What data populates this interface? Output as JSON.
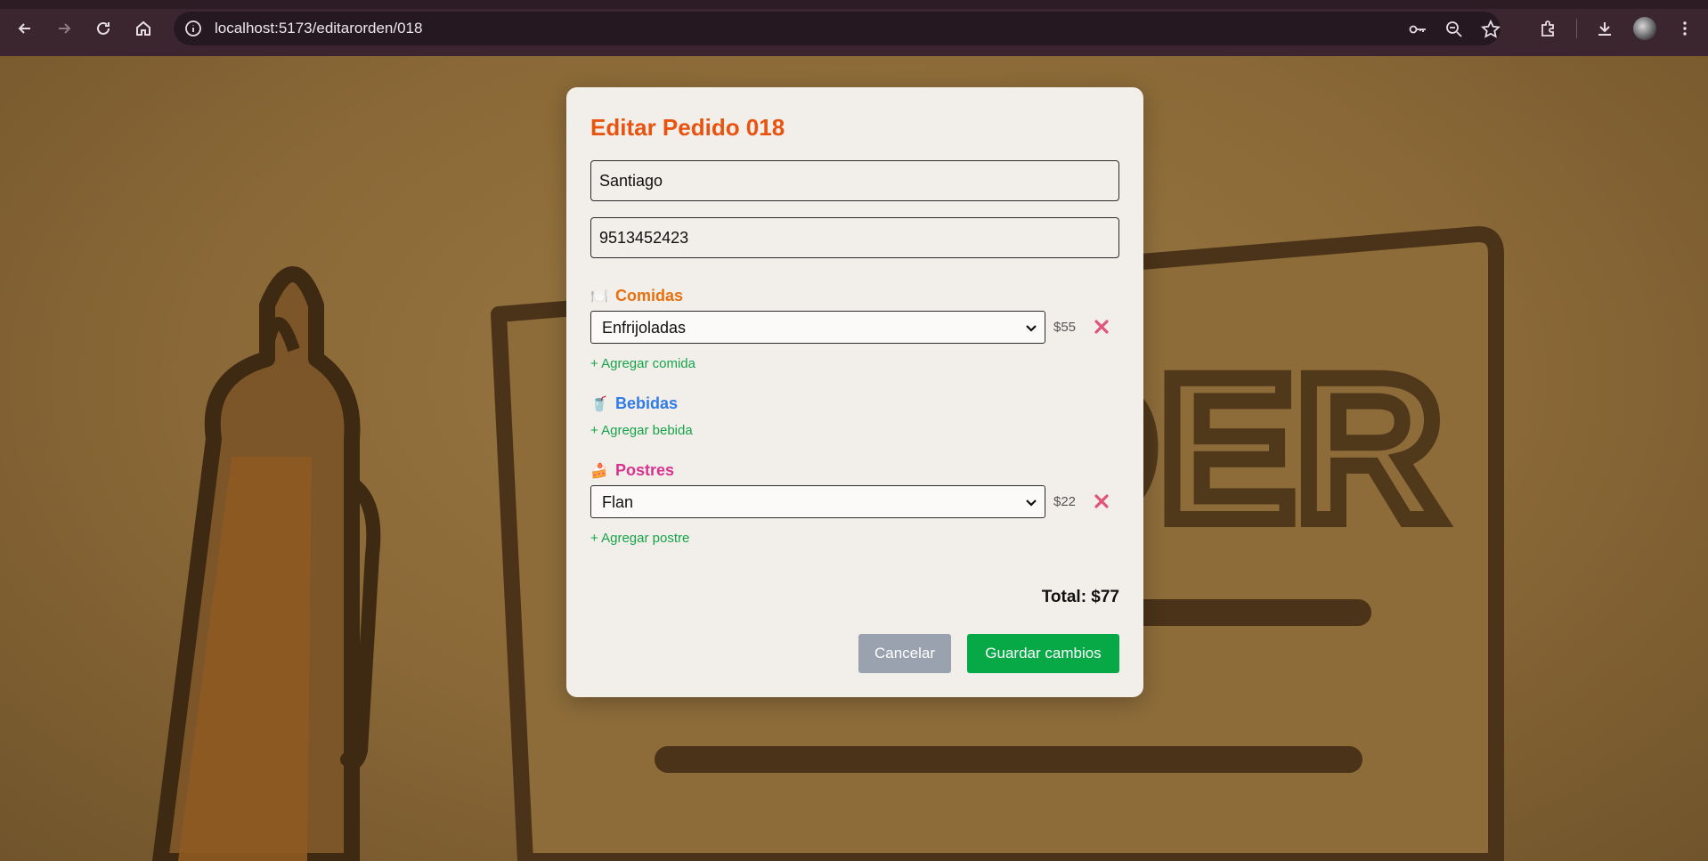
{
  "browser": {
    "url": "localhost:5173/editarorden/018"
  },
  "modal": {
    "title": "Editar Pedido 018",
    "customer_name": "Santiago",
    "phone": "9513452423",
    "sections": {
      "comidas": {
        "label": "Comidas",
        "emoji": "🍽️",
        "color": "#e8700f",
        "items": [
          {
            "name": "Enfrijoladas",
            "price": "$55"
          }
        ],
        "add_label": "+ Agregar comida"
      },
      "bebidas": {
        "label": "Bebidas",
        "emoji": "🥤",
        "color": "#2f7be8",
        "items": [],
        "add_label": "+ Agregar bebida"
      },
      "postres": {
        "label": "Postres",
        "emoji": "🍰",
        "color": "#d6338f",
        "items": [
          {
            "name": "Flan",
            "price": "$22"
          }
        ],
        "add_label": "+ Agregar postre"
      }
    },
    "total": "Total: $77",
    "cancel_label": "Cancelar",
    "save_label": "Guardar cambios"
  },
  "colors": {
    "title": "#e8530f",
    "add_link": "#16a34a",
    "remove": "#e0567a",
    "save_button": "#07a846",
    "cancel_button": "#9aa2b0"
  }
}
